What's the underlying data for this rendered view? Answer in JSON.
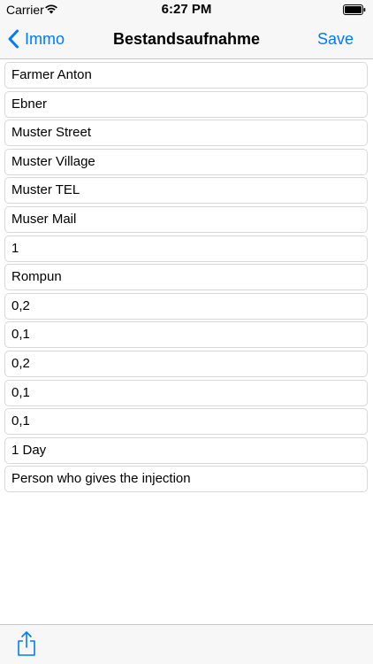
{
  "status_bar": {
    "carrier": "Carrier",
    "time": "6:27 PM"
  },
  "nav": {
    "back_label": "Immo",
    "title": "Bestandsaufnahme",
    "save_label": "Save"
  },
  "fields": [
    {
      "value": "Farmer Anton"
    },
    {
      "value": "Ebner"
    },
    {
      "value": "Muster Street"
    },
    {
      "value": "Muster Village"
    },
    {
      "value": "Muster TEL"
    },
    {
      "value": "Muser Mail"
    },
    {
      "value": "1"
    },
    {
      "value": "Rompun"
    },
    {
      "value": "0,2"
    },
    {
      "value": "0,1"
    },
    {
      "value": "0,2"
    },
    {
      "value": "0,1"
    },
    {
      "value": "0,1"
    },
    {
      "value": "1 Day"
    },
    {
      "value": "Person who gives the injection"
    }
  ],
  "toolbar": {
    "share_icon": "share-icon"
  },
  "colors": {
    "accent": "#007aff",
    "bar_background": "#f7f7f7",
    "field_border": "#d8d8d8"
  }
}
